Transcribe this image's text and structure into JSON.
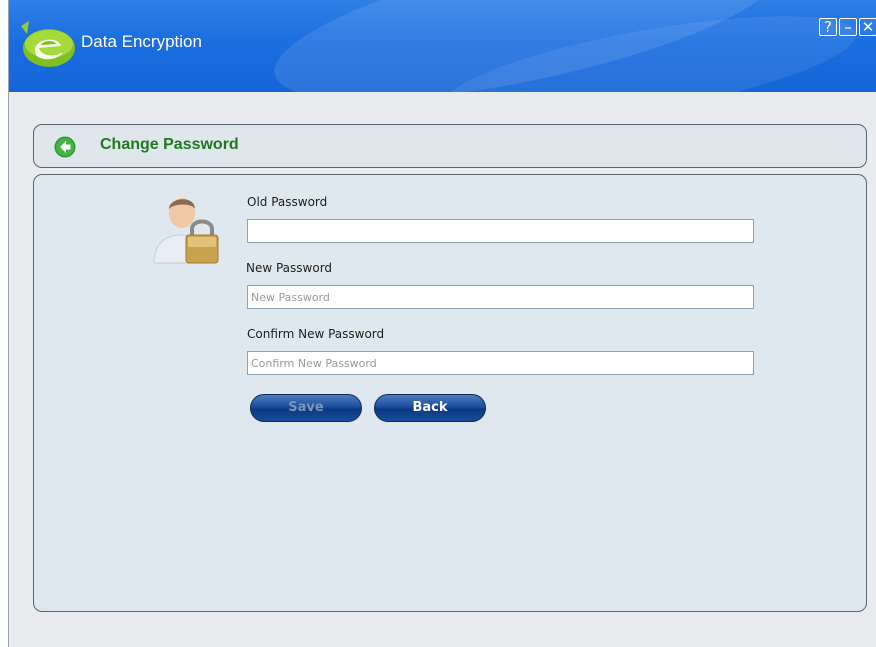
{
  "window": {
    "title": "Data Encryption",
    "controls": {
      "help": "?",
      "minimize": "–",
      "close": "✕"
    }
  },
  "header": {
    "title": "Change Password"
  },
  "form": {
    "old_password": {
      "label": "Old Password",
      "value": "",
      "placeholder": ""
    },
    "new_password": {
      "label": "New Password",
      "value": "",
      "placeholder": "New Password"
    },
    "confirm_password": {
      "label": "Confirm New Password",
      "value": "",
      "placeholder": "Confirm New Password"
    },
    "save_label": "Save",
    "back_label": "Back"
  },
  "icons": {
    "logo": "e-logo-icon",
    "back": "back-arrow-icon",
    "user_lock": "user-lock-icon"
  },
  "colors": {
    "titlebar": "#1b6ee0",
    "title_green": "#1f7a1f",
    "button_blue": "#1a4e9c"
  }
}
